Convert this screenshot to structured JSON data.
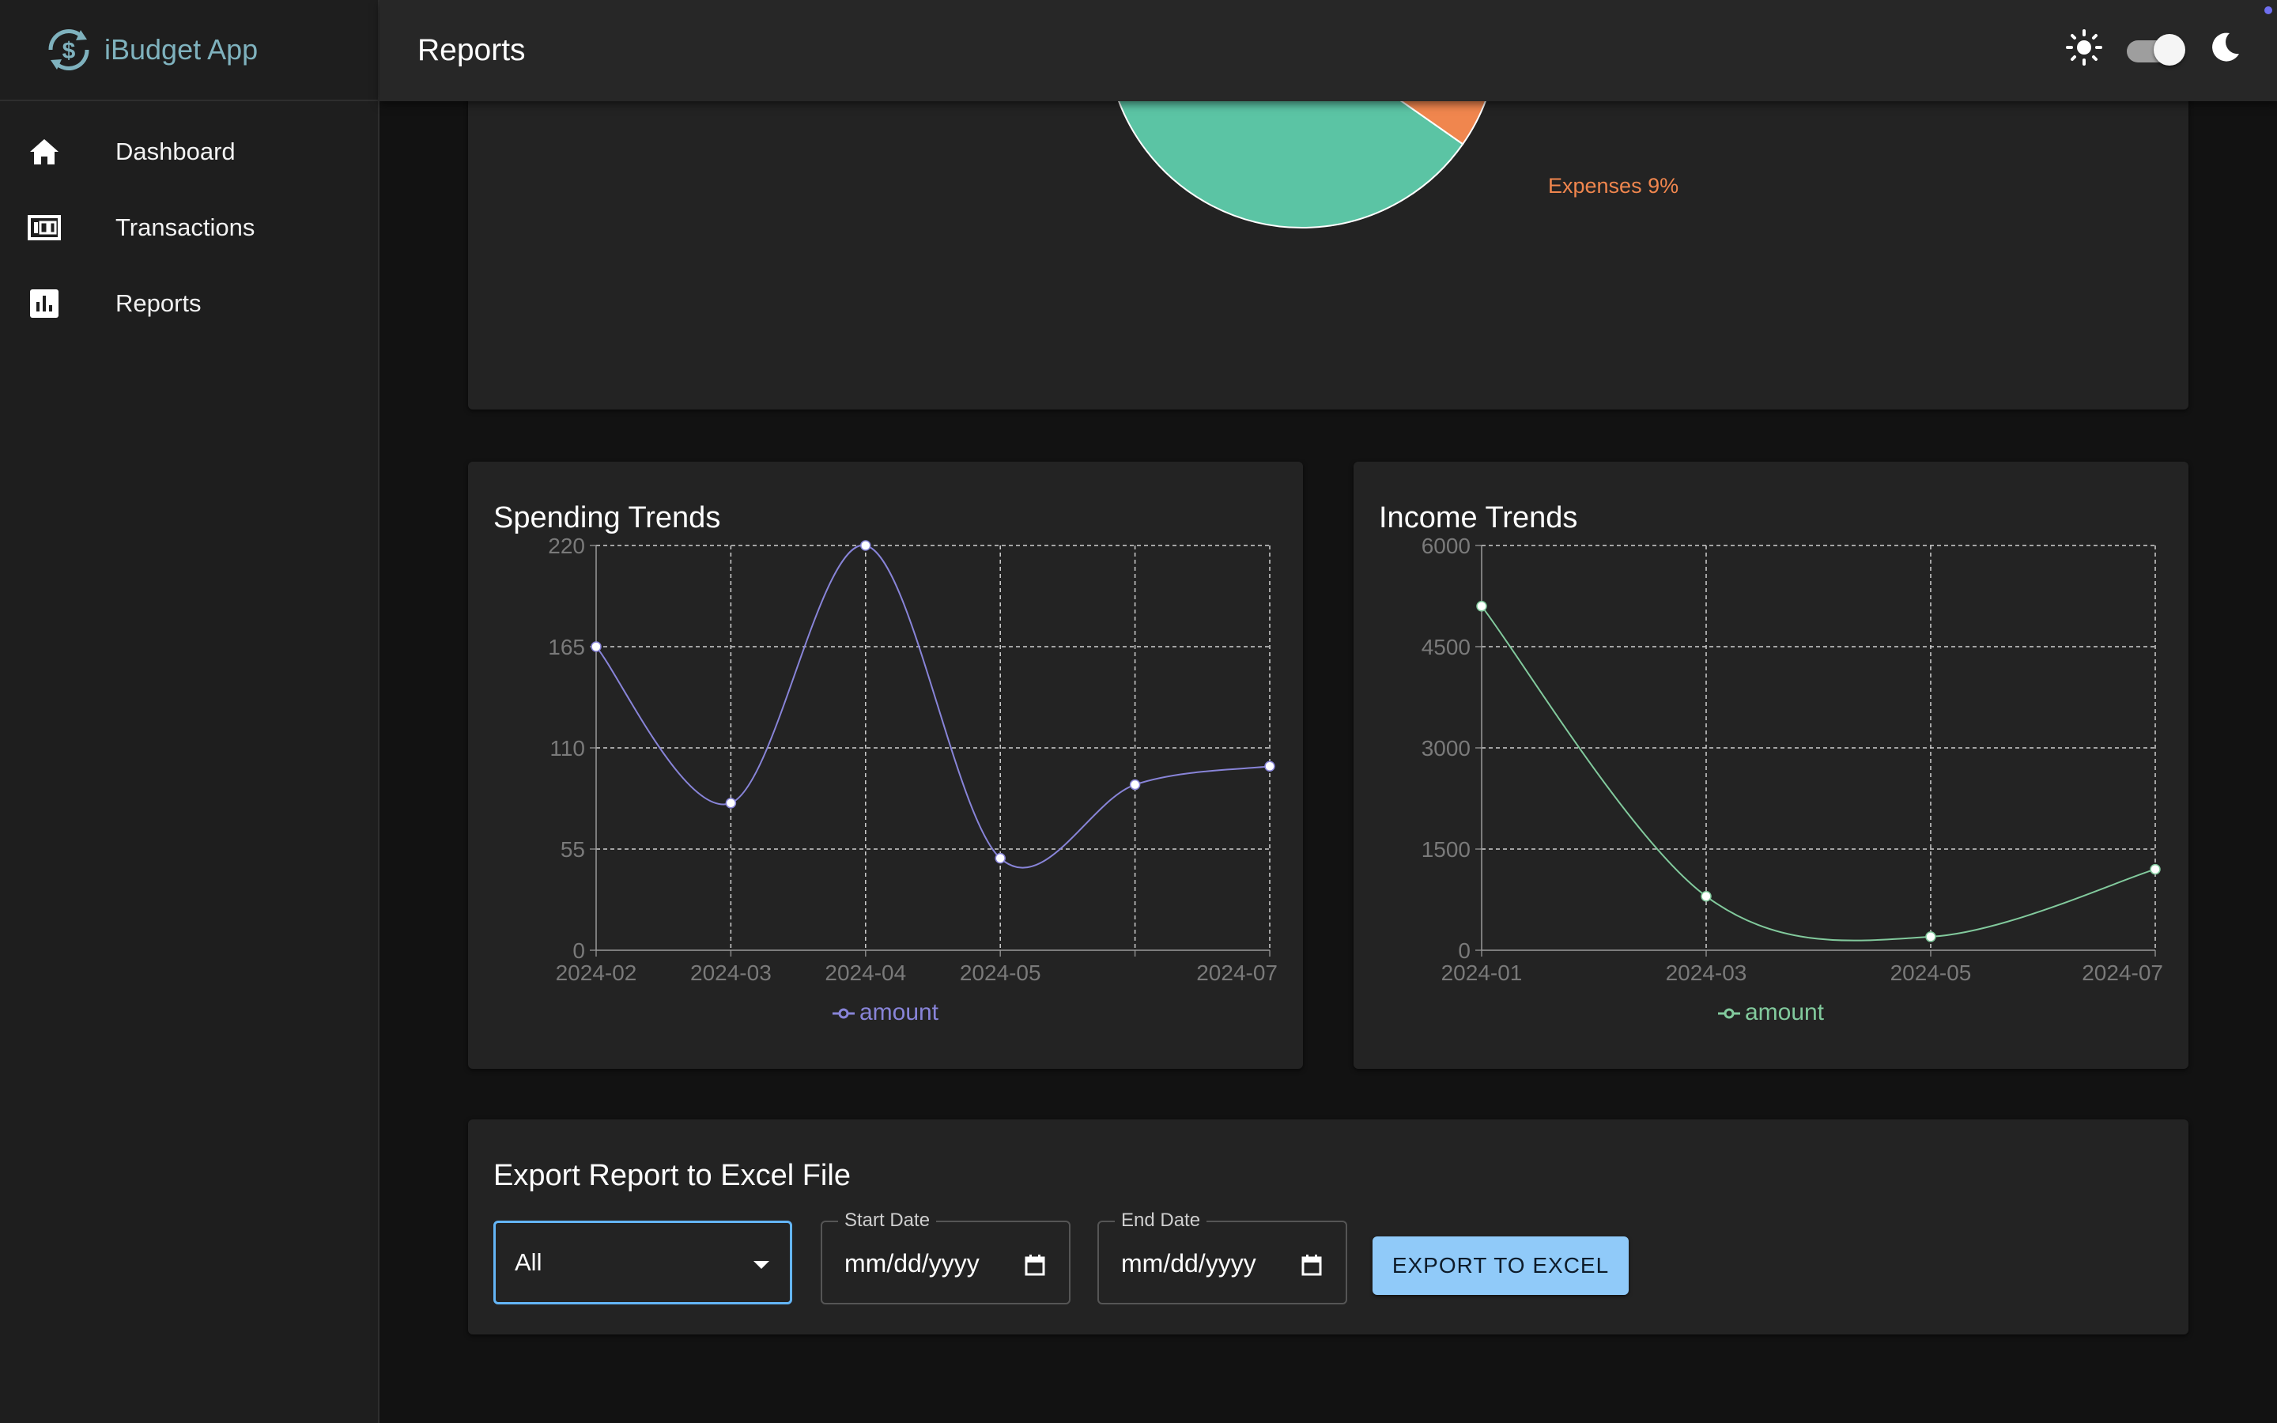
{
  "app": {
    "name": "iBudget App",
    "page_title": "Reports"
  },
  "sidebar": {
    "items": [
      {
        "label": "Dashboard",
        "icon": "home-icon"
      },
      {
        "label": "Transactions",
        "icon": "money-icon"
      },
      {
        "label": "Reports",
        "icon": "bar-chart-icon"
      }
    ]
  },
  "theme_toggle": {
    "light_icon": "sun-icon",
    "dark_icon": "moon-icon",
    "dark_mode": true
  },
  "pie": {
    "label": "Expenses 9%",
    "colors": {
      "income": "#5bc4a4",
      "expenses": "#f0864e"
    }
  },
  "chart_data": [
    {
      "type": "line",
      "title": "Spending Trends",
      "x": [
        "2024-02",
        "2024-03",
        "2024-04",
        "2024-05",
        "2024-06",
        "2024-07"
      ],
      "x_tick_labels": [
        "2024-02",
        "2024-03",
        "2024-04",
        "2024-05",
        "",
        "2024-07"
      ],
      "series": [
        {
          "name": "amount",
          "values": [
            165,
            80,
            220,
            50,
            90,
            100
          ],
          "color": "#8884d8"
        }
      ],
      "yticks": [
        0,
        55,
        110,
        165,
        220
      ],
      "ylim": [
        0,
        220
      ],
      "grid": true,
      "legend": "bottom"
    },
    {
      "type": "line",
      "title": "Income Trends",
      "x": [
        "2024-01",
        "2024-03",
        "2024-05",
        "2024-07"
      ],
      "x_tick_labels": [
        "2024-01",
        "2024-03",
        "2024-05",
        "2024-07"
      ],
      "series": [
        {
          "name": "amount",
          "values": [
            5100,
            800,
            200,
            1200
          ],
          "color": "#82ca9d"
        }
      ],
      "yticks": [
        0,
        1500,
        3000,
        4500,
        6000
      ],
      "ylim": [
        0,
        6000
      ],
      "grid": true,
      "legend": "bottom"
    }
  ],
  "export": {
    "title": "Export Report to Excel File",
    "type_select": "All",
    "start_date": {
      "label": "Start Date",
      "placeholder": "mm/dd/yyyy"
    },
    "end_date": {
      "label": "End Date",
      "placeholder": "mm/dd/yyyy"
    },
    "button": "EXPORT TO EXCEL"
  }
}
